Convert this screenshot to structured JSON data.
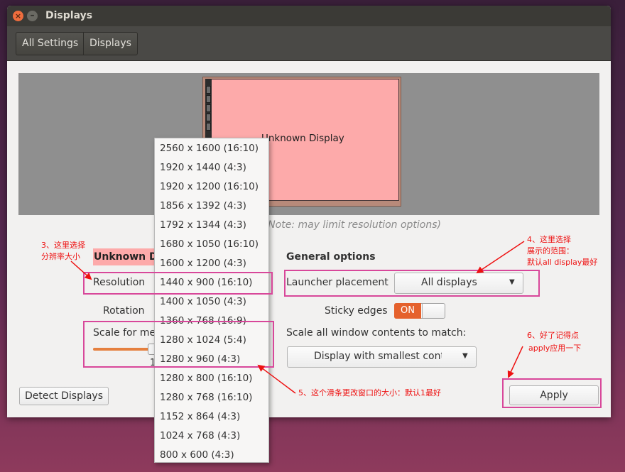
{
  "window": {
    "title": "Displays",
    "toolbar": {
      "all_settings": "All Settings",
      "displays": "Displays"
    }
  },
  "preview": {
    "monitor_label": "Unknown Display"
  },
  "left_panel": {
    "display_name": "Unknown Di",
    "resolution_label": "Resolution",
    "rotation_label": "Rotation",
    "scale_label": "Scale for mer",
    "scale_value": "1",
    "note": "s (Note: may limit resolution options)",
    "detect_button": "Detect Displays"
  },
  "general_options": {
    "title": "General options",
    "launcher_label": "Launcher placement",
    "launcher_value": "All displays",
    "sticky_label": "Sticky edges",
    "sticky_state": "ON",
    "scale_all_label": "Scale all window contents to match:",
    "scale_all_value": "Display with smallest cont",
    "apply_button": "Apply"
  },
  "resolution_menu": [
    "2560 x 1600 (16:10)",
    "1920 x 1440 (4:3)",
    "1920 x 1200 (16:10)",
    "1856 x 1392 (4:3)",
    "1792 x 1344 (4:3)",
    "1680 x 1050 (16:10)",
    "1600 x 1200 (4:3)",
    "1440 x 900 (16:10)",
    "1400 x 1050 (4:3)",
    "1360 x 768 (16:9)",
    "1280 x 1024 (5:4)",
    "1280 x 960 (4:3)",
    "1280 x 800 (16:10)",
    "1280 x 768 (16:10)",
    "1152 x 864 (4:3)",
    "1024 x 768 (4:3)",
    "800 x 600 (4:3)"
  ],
  "annotations": {
    "ann3": [
      "3、这里选择",
      "分辨率大小"
    ],
    "ann4": [
      "4、这里选择",
      "展示的范围：",
      "默认all display最好"
    ],
    "ann5": "5、这个滑条更改窗口的大小：默认1最好",
    "ann6": [
      "6、好了记得点",
      "apply应用一下"
    ]
  },
  "colors": {
    "accent": "#e5612c",
    "monitor": "#fdaaaa",
    "annotation_box": "#d8479a",
    "annotation_text": "#ee1111"
  }
}
